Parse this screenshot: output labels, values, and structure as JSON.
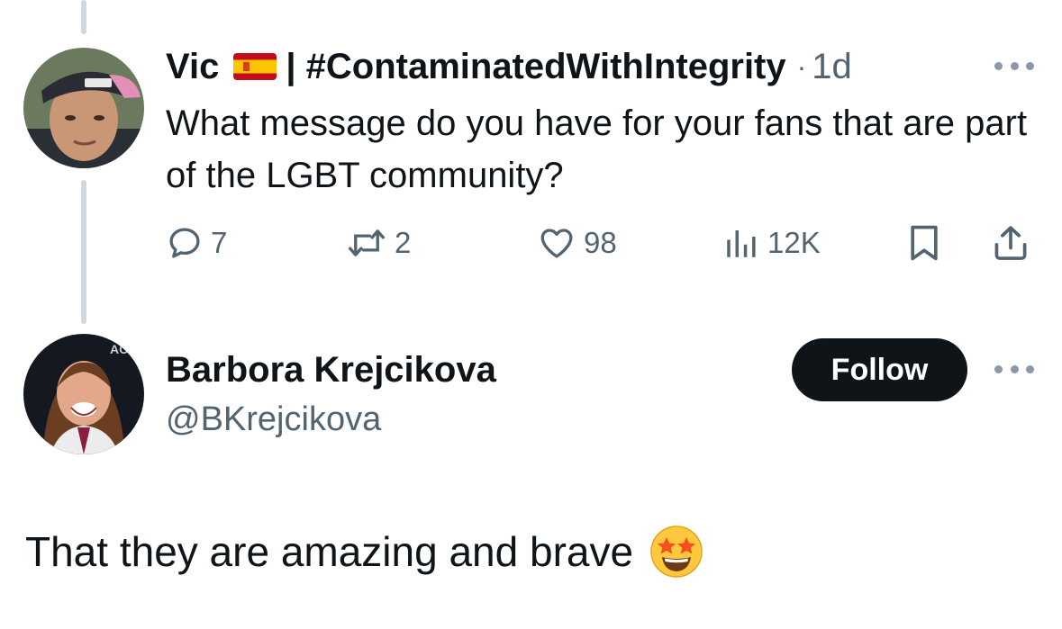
{
  "reply": {
    "display_name": "Vic",
    "flag_icon": "spain-flag-icon",
    "name_rest": "| #ContaminatedWithIntegrity",
    "separator": "·",
    "timestamp": "1d",
    "text": "What message do you have for your fans that are part of the LGBT community?",
    "stats": {
      "replies": "7",
      "retweets": "2",
      "likes": "98",
      "views": "12K"
    }
  },
  "main_tweet": {
    "display_name": "Barbora Krejcikova",
    "handle": "@BKrejcikova",
    "follow_label": "Follow",
    "text": "That they are amazing and brave",
    "emoji": "star-struck-emoji"
  },
  "colors": {
    "text_primary": "#0f1419",
    "text_secondary": "#536471",
    "thread_line": "#cfd9de",
    "follow_bg": "#0f1419",
    "follow_text": "#ffffff"
  }
}
